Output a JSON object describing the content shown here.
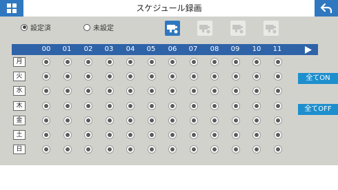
{
  "header": {
    "title": "スケジュール録画"
  },
  "legend": {
    "set_label": "設定済",
    "unset_label": "未設定"
  },
  "hours": [
    "00",
    "01",
    "02",
    "03",
    "04",
    "05",
    "06",
    "07",
    "08",
    "09",
    "10",
    "11"
  ],
  "days": [
    "月",
    "火",
    "水",
    "木",
    "金",
    "土",
    "日"
  ],
  "cameras": [
    {
      "name": "camera-1",
      "active": true
    },
    {
      "name": "camera-2",
      "active": false
    },
    {
      "name": "camera-3",
      "active": false
    },
    {
      "name": "camera-4",
      "active": false
    }
  ],
  "buttons": {
    "all_on": "全てON",
    "all_off": "全てOFF"
  },
  "colors": {
    "accent": "#2f78c0",
    "bar": "#2f63a8",
    "side_button": "#1e8fcd",
    "panel": "#d2d2cd"
  }
}
